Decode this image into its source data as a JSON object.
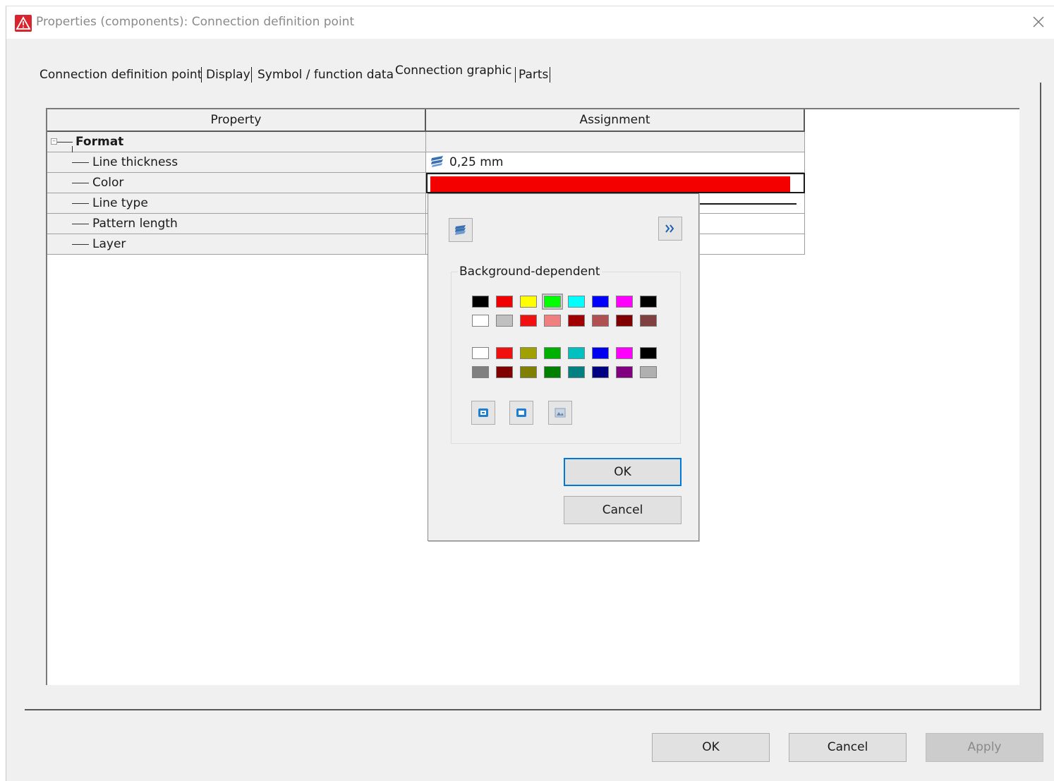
{
  "window": {
    "title": "Properties (components): Connection definition point"
  },
  "tabs": [
    {
      "label": "Connection definition point"
    },
    {
      "label": "Display"
    },
    {
      "label": "Symbol / function data"
    },
    {
      "label": "Connection graphic"
    },
    {
      "label": "Parts"
    }
  ],
  "active_tab": "Connection graphic",
  "table": {
    "headers": {
      "property": "Property",
      "assignment": "Assignment"
    },
    "group": {
      "label": "Format"
    },
    "rows": [
      {
        "label": "Line thickness",
        "value": "0,25 mm"
      },
      {
        "label": "Color",
        "value": ""
      },
      {
        "label": "Line type",
        "value": ""
      },
      {
        "label": "Pattern length",
        "value": ""
      },
      {
        "label": "Layer",
        "value": ""
      }
    ]
  },
  "colors": {
    "selected_color": "#f50000",
    "accent": "#0078d7",
    "app_icon": "#d9232e"
  },
  "color_picker": {
    "group_title": "Background-dependent",
    "palette_rows": [
      [
        "#000000",
        "#f00000",
        "#ffff00",
        "#00ff00",
        "#00ffff",
        "#0000ff",
        "#ff00ff",
        "#000000"
      ],
      [
        "#ffffff",
        "#c0c0c0",
        "#f01010",
        "#f08080",
        "#a00000",
        "#b05050",
        "#800000",
        "#804040"
      ],
      [
        "#ffffff",
        "#f01010",
        "#a0a000",
        "#00b000",
        "#00c0c0",
        "#0000f0",
        "#ff00ff",
        "#000000"
      ],
      [
        "#808080",
        "#800000",
        "#808000",
        "#008000",
        "#008080",
        "#000080",
        "#800080",
        "#b0b0b0"
      ]
    ],
    "selected_swatch": "0-3",
    "ok_label": "OK",
    "cancel_label": "Cancel"
  },
  "buttons": {
    "ok": "OK",
    "cancel": "Cancel",
    "apply": "Apply"
  }
}
